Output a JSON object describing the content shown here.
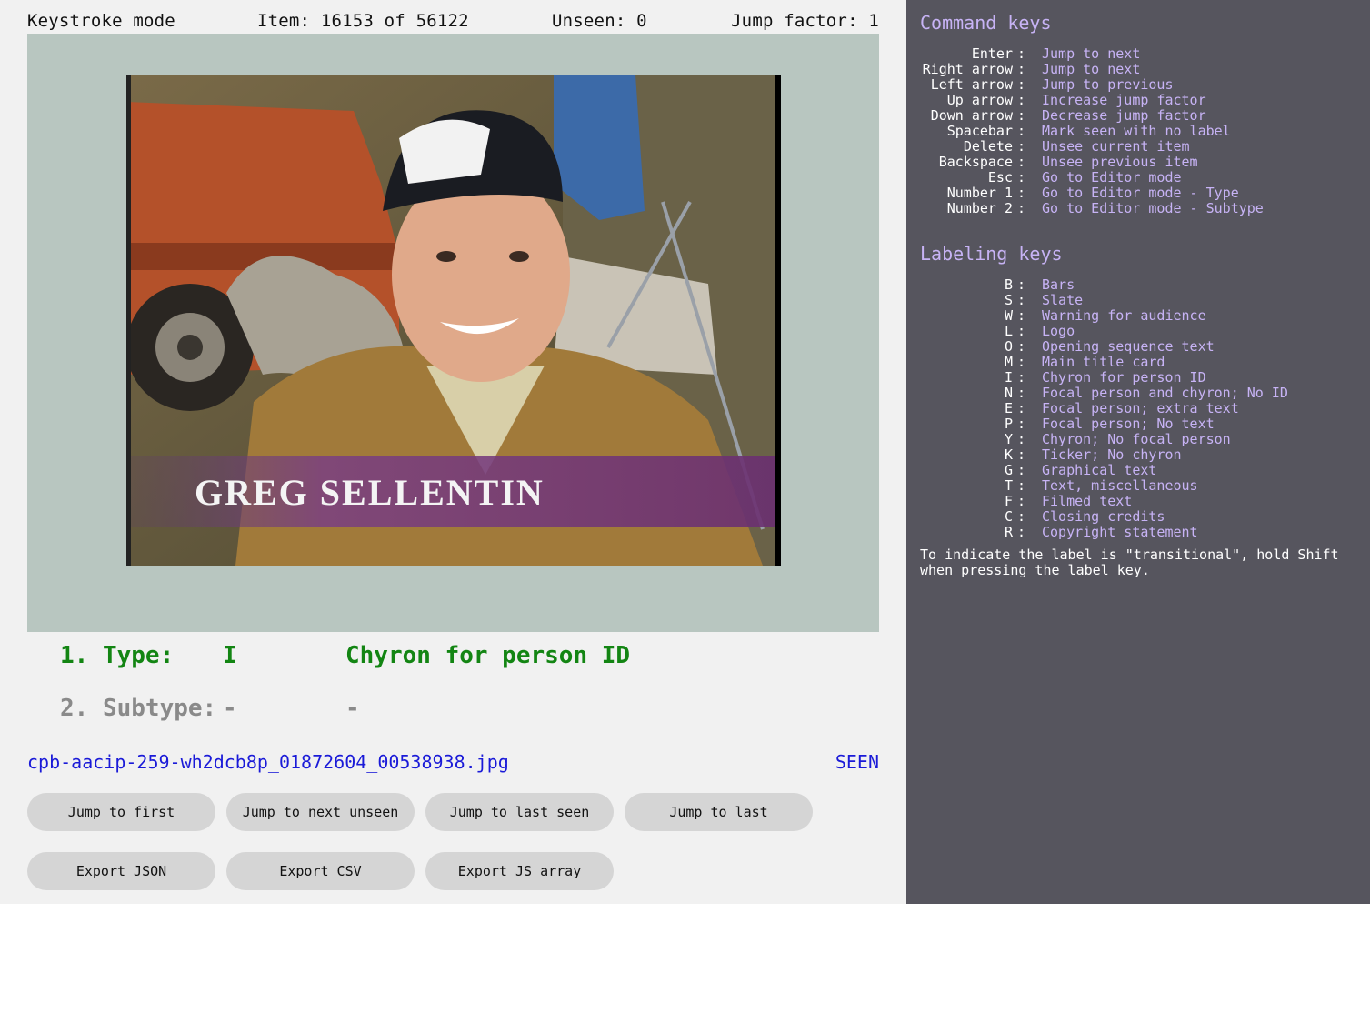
{
  "status": {
    "mode": "Keystroke mode",
    "item": "Item: 16153 of 56122",
    "unseen": "Unseen: 0",
    "jump_factor": "Jump factor: 1"
  },
  "frame": {
    "chyron_text": "GREG SELLENTIN"
  },
  "labels": {
    "type": {
      "prefix": "1. Type:",
      "code": "I",
      "name": "Chyron for person ID",
      "color": "#138513"
    },
    "subtype": {
      "prefix": "2. Subtype:",
      "code": "-",
      "name": "-",
      "color": "#8a8a8a"
    }
  },
  "file": {
    "name": "cpb-aacip-259-wh2dcb8p_01872604_00538938.jpg",
    "state": "SEEN"
  },
  "buttons": {
    "jump_first": "Jump to first",
    "jump_next_unseen": "Jump to next unseen",
    "jump_last_seen": "Jump to last seen",
    "jump_last": "Jump to last",
    "export_json": "Export JSON",
    "export_csv": "Export CSV",
    "export_js": "Export JS array"
  },
  "command_panel": {
    "title": "Command keys",
    "keys": [
      {
        "key": "Enter",
        "desc": "Jump to next"
      },
      {
        "key": "Right arrow",
        "desc": "Jump to next"
      },
      {
        "key": "Left arrow",
        "desc": "Jump to previous"
      },
      {
        "key": "Up arrow",
        "desc": "Increase jump factor"
      },
      {
        "key": "Down arrow",
        "desc": "Decrease jump factor"
      },
      {
        "key": "Spacebar",
        "desc": "Mark seen with no label"
      },
      {
        "key": "Delete",
        "desc": "Unsee current item"
      },
      {
        "key": "Backspace",
        "desc": "Unsee previous item"
      },
      {
        "key": "Esc",
        "desc": "Go to Editor mode"
      },
      {
        "key": "Number 1",
        "desc": "Go to Editor mode - Type"
      },
      {
        "key": "Number 2",
        "desc": "Go to Editor mode - Subtype"
      }
    ]
  },
  "labeling_panel": {
    "title": "Labeling keys",
    "keys": [
      {
        "key": "B",
        "desc": "Bars"
      },
      {
        "key": "S",
        "desc": "Slate"
      },
      {
        "key": "W",
        "desc": "Warning for audience"
      },
      {
        "key": "L",
        "desc": "Logo"
      },
      {
        "key": "O",
        "desc": "Opening sequence text"
      },
      {
        "key": "M",
        "desc": "Main title card"
      },
      {
        "key": "I",
        "desc": "Chyron for person ID"
      },
      {
        "key": "N",
        "desc": "Focal person and chyron; No ID"
      },
      {
        "key": "E",
        "desc": "Focal person; extra text"
      },
      {
        "key": "P",
        "desc": "Focal person; No text"
      },
      {
        "key": "Y",
        "desc": "Chyron; No focal person"
      },
      {
        "key": "K",
        "desc": "Ticker; No chyron"
      },
      {
        "key": "G",
        "desc": "Graphical text"
      },
      {
        "key": "T",
        "desc": "Text, miscellaneous"
      },
      {
        "key": "F",
        "desc": "Filmed text"
      },
      {
        "key": "C",
        "desc": "Closing credits"
      },
      {
        "key": "R",
        "desc": "Copyright statement"
      }
    ],
    "note": "To indicate the label is \"transitional\", hold Shift when pressing the label key."
  },
  "colors": {
    "left_bg": "#f1f1f1",
    "right_bg": "#56555e",
    "viewer_bg": "#b8c6c0",
    "accent": "#c7b3f5",
    "link_blue": "#1a1ad8"
  }
}
